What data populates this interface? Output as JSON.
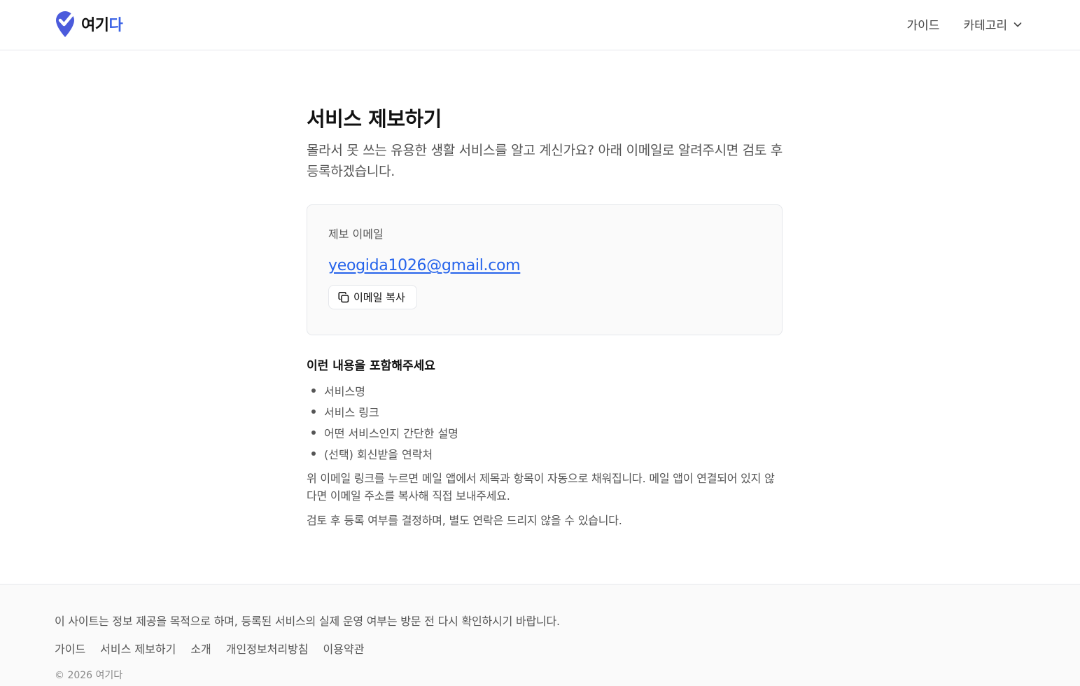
{
  "header": {
    "logo": {
      "part1": "여기",
      "part2": "다",
      "icon": "location-check-icon"
    },
    "nav": {
      "guide": "가이드",
      "category": "카테고리",
      "category_icon": "chevron-down-icon"
    }
  },
  "main": {
    "title": "서비스 제보하기",
    "description": "몰라서 못 쓰는 유용한 생활 서비스를 알고 계신가요? 아래 이메일로 알려주시면 검토 후 등록하겠습니다.",
    "card": {
      "label": "제보 이메일",
      "email": "yeogida1026@gmail.com",
      "copy_button": "이메일 복사",
      "copy_icon": "copy-icon"
    },
    "include_heading": "이런 내용을 포함해주세요",
    "include_items": [
      "서비스명",
      "서비스 링크",
      "어떤 서비스인지 간단한 설명",
      "(선택) 회신받을 연락처"
    ],
    "note1": "위 이메일 링크를 누르면 메일 앱에서 제목과 항목이 자동으로 채워집니다. 메일 앱이 연결되어 있지 않다면 이메일 주소를 복사해 직접 보내주세요.",
    "note2": "검토 후 등록 여부를 결정하며, 별도 연락은 드리지 않을 수 있습니다."
  },
  "footer": {
    "disclaimer": "이 사이트는 정보 제공을 목적으로 하며, 등록된 서비스의 실제 운영 여부는 방문 전 다시 확인하시기 바랍니다.",
    "links": [
      "가이드",
      "서비스 제보하기",
      "소개",
      "개인정보처리방침",
      "이용약관"
    ],
    "copyright": "© 2026 여기다"
  },
  "colors": {
    "brand_blue": "#3b63e6",
    "link_blue": "#2563eb",
    "logo_pin": "#4b5bdc"
  }
}
